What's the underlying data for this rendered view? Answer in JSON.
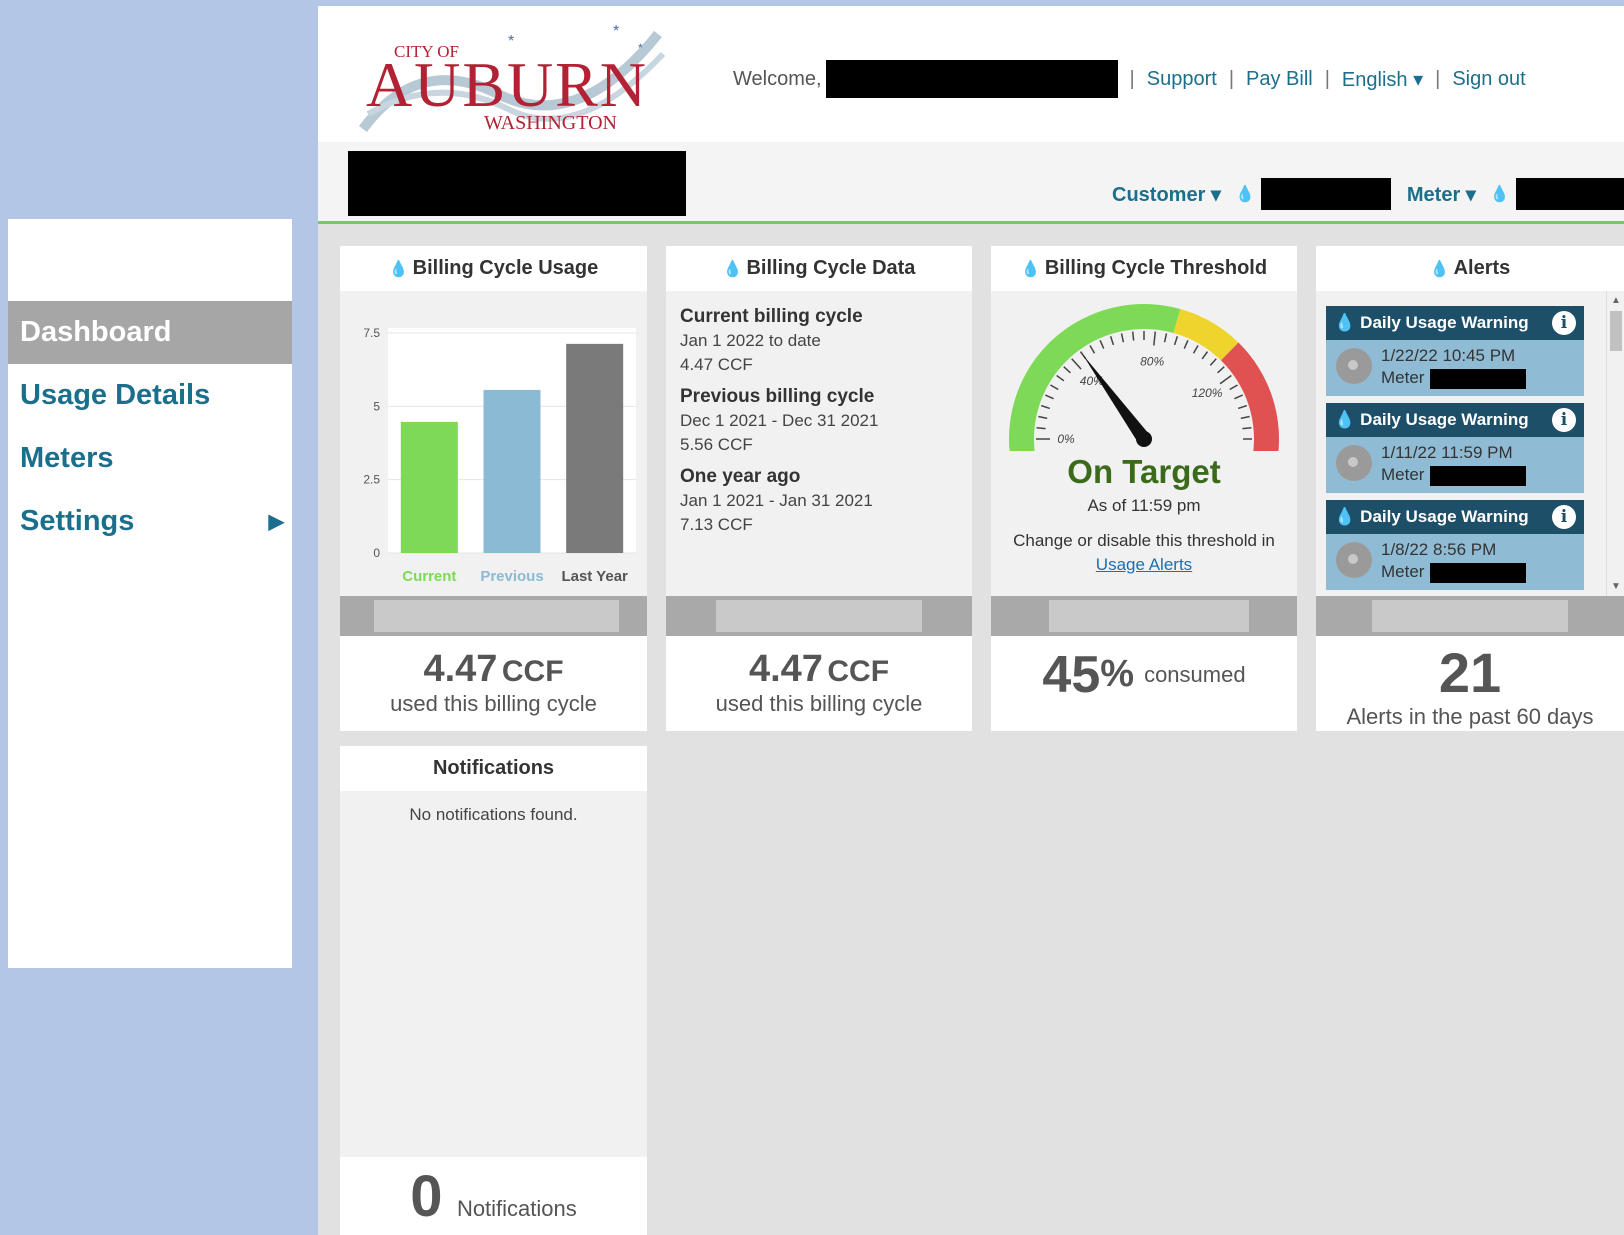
{
  "logo": {
    "city_of": "CITY OF",
    "name": "AUBURN",
    "state": "WASHINGTON"
  },
  "header": {
    "welcome": "Welcome,",
    "links": [
      "Support",
      "Pay Bill",
      "English ▾",
      "Sign out"
    ]
  },
  "subheader": {
    "customer_label": "Customer ▾",
    "meter_label": "Meter ▾"
  },
  "sidebar": {
    "items": [
      {
        "label": "Dashboard"
      },
      {
        "label": "Usage Details"
      },
      {
        "label": "Meters"
      },
      {
        "label": "Settings"
      }
    ]
  },
  "cards": {
    "usage": {
      "title": "Billing Cycle Usage",
      "footer_value": "4.47",
      "footer_unit": "CCF",
      "footer_label": "used this billing cycle"
    },
    "data": {
      "title": "Billing Cycle Data",
      "current_head": "Current billing cycle",
      "current_range": "Jan 1 2022 to date",
      "current_value": "4.47 CCF",
      "previous_head": "Previous billing cycle",
      "previous_range": "Dec 1 2021 - Dec 31 2021",
      "previous_value": "5.56 CCF",
      "year_head": "One year ago",
      "year_range": "Jan 1 2021 - Jan 31 2021",
      "year_value": "7.13 CCF",
      "footer_value": "4.47",
      "footer_unit": "CCF",
      "footer_label": "used this billing cycle"
    },
    "threshold": {
      "title": "Billing Cycle Threshold",
      "status": "On Target",
      "as_of": "As of 11:59 pm",
      "change_text": "Change or disable this threshold in",
      "link": "Usage Alerts",
      "gauge_ticks": [
        "0%",
        "40%",
        "80%",
        "120%"
      ],
      "gauge_value": 45,
      "footer_value": "45",
      "footer_unit": "%",
      "footer_label": "consumed"
    },
    "alerts": {
      "title": "Alerts",
      "items": [
        {
          "title": "Daily Usage Warning",
          "date": "1/22/22 10:45 PM",
          "meter": "Meter"
        },
        {
          "title": "Daily Usage Warning",
          "date": "1/11/22 11:59 PM",
          "meter": "Meter"
        },
        {
          "title": "Daily Usage Warning",
          "date": "1/8/22 8:56 PM",
          "meter": "Meter"
        }
      ],
      "footer_value": "21",
      "footer_label": "Alerts in the past 60 days"
    },
    "notifications": {
      "title": "Notifications",
      "empty": "No notifications found.",
      "footer_value": "0",
      "footer_label": "Notifications"
    }
  },
  "chart_data": {
    "type": "bar",
    "categories": [
      "Current",
      "Previous",
      "Last Year"
    ],
    "values": [
      4.47,
      5.56,
      7.13
    ],
    "colors": [
      "#7ed957",
      "#8bbbd4",
      "#7a7a7a"
    ],
    "yticks": [
      "0",
      "2.5",
      "5",
      "7.5"
    ],
    "ylim": [
      0,
      7.5
    ]
  }
}
